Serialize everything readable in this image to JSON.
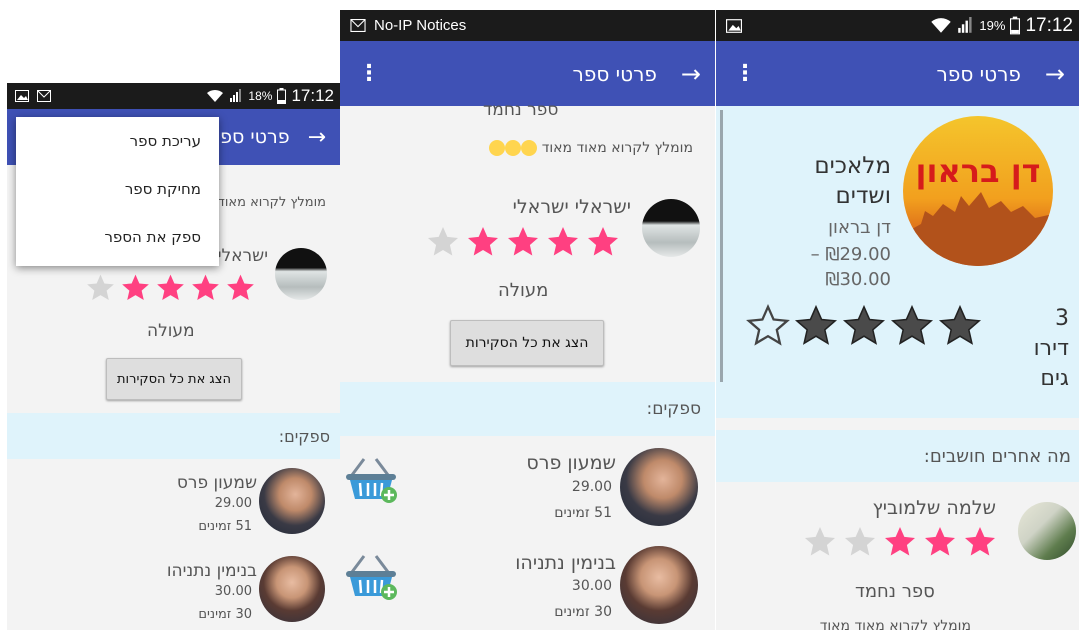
{
  "status": {
    "left_time": "17:12",
    "left_battery": "18%",
    "middle_notification": "No-IP Notices",
    "right_time": "17:12",
    "right_battery": "19%"
  },
  "appbar": {
    "title": "פרטי ספר"
  },
  "menu": {
    "edit": "עריכת ספר",
    "delete": "מחיקת ספר",
    "supply": "ספק את הספר"
  },
  "book": {
    "title_line1": "מלאכים",
    "title_line2": "ושדים",
    "author": "דן בראון",
    "price_new": "₪29.00 –",
    "price_old": "₪30.00",
    "ratings_count": "3",
    "ratings_word_line1": "דירו",
    "ratings_word_line2": "גים",
    "rating": 4,
    "cover_title": "דן בראון"
  },
  "reviews": {
    "header": "מה אחרים חושבים:",
    "items": [
      {
        "name": "ישראלי ישראלי",
        "stars": 4,
        "title": "מעולה"
      },
      {
        "name": "שלמה שלמוביץ",
        "stars": 3,
        "title": "ספר נחמד",
        "body": "מומלץ לקרוא מאוד מאוד"
      }
    ],
    "prev_title": "ספר נחמד",
    "prev_body": "מומלץ לקרוא מאוד מאוד",
    "show_all": "הצג את כל הסקירות"
  },
  "suppliers": {
    "header": "ספקים:",
    "unit": "זמינים",
    "items": [
      {
        "name": "שמעון פרס",
        "price": "29.00",
        "available": "51"
      },
      {
        "name": "בנימין נתניהו",
        "price": "30.00",
        "available": "30"
      }
    ]
  },
  "colors": {
    "primary": "#3f51b5",
    "accent": "#ff4081",
    "band": "#dff3fb"
  }
}
